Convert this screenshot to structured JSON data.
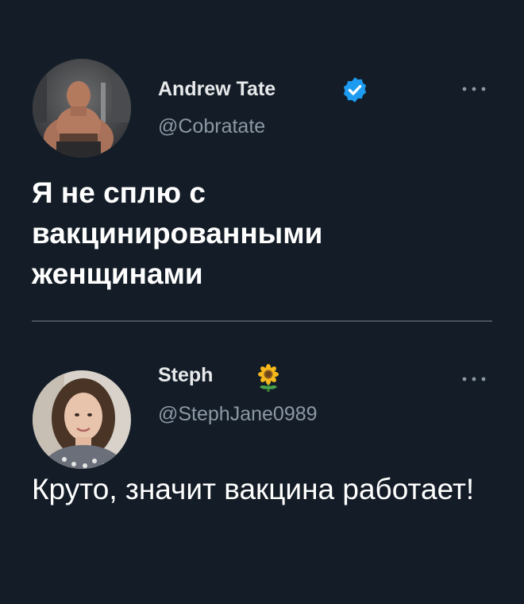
{
  "tweets": [
    {
      "display_name": "Andrew Tate",
      "handle": "@Cobratate",
      "verified": true,
      "avatar": "avatar-man-gym-photo",
      "more_icon": "more-options-icon",
      "text": "Я не сплю с вакцинированными женщинами"
    },
    {
      "display_name": "Steph",
      "handle": "@StephJane0989",
      "name_emoji": "sunflower-icon",
      "avatar": "avatar-woman-photo",
      "more_icon": "more-options-icon",
      "text": "Круто, значит вакцина работает!"
    }
  ],
  "colors": {
    "background": "#141d27",
    "name": "#e7e9ea",
    "handle": "#8b98a5",
    "text": "#ffffff",
    "verified": "#1d9bf0",
    "divider": "#4a535d"
  }
}
